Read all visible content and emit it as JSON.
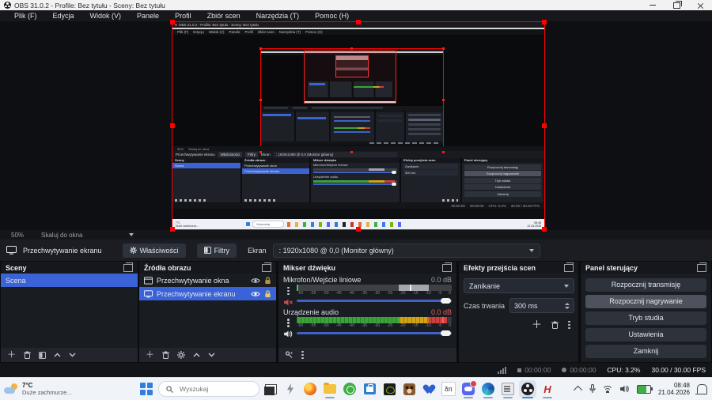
{
  "window": {
    "title": "OBS 31.0.2 - Profile: Bez tytułu - Sceny: Bez tytułu"
  },
  "menu": {
    "items": [
      "Plik (F)",
      "Edycja",
      "Widok (V)",
      "Panele",
      "Profil",
      "Zbiór scen",
      "Narzędzia (T)",
      "Pomoc (H)"
    ]
  },
  "preview": {
    "zoom_label": "50%",
    "scale_mode": "Skaluj do okna"
  },
  "context_bar": {
    "source_label": "Przechwytywanie ekranu",
    "properties_label": "Właściwości",
    "filters_label": "Filtry",
    "screen_label": "Ekran",
    "screen_value": ": 1920x1080 @ 0,0 (Monitor główny)"
  },
  "scenes": {
    "title": "Sceny",
    "items": [
      {
        "label": "Scena",
        "selected": true
      }
    ]
  },
  "sources": {
    "title": "Źródła obrazu",
    "items": [
      {
        "label": "Przechwytywanie okna",
        "selected": false
      },
      {
        "label": "Przechwytywanie ekranu",
        "selected": true
      }
    ]
  },
  "mixer": {
    "title": "Mikser dźwięku",
    "channels": [
      {
        "name": "Mikrofon/Wejście liniowe",
        "level": "0.0 dB",
        "muted": true
      },
      {
        "name": "Urządzenie audio",
        "level": "0.0 dB",
        "muted": false
      }
    ],
    "ticks": [
      "-60",
      "-55",
      "-50",
      "-45",
      "-40",
      "-35",
      "-30",
      "-25",
      "-20",
      "-15",
      "-10",
      "-5",
      "0"
    ]
  },
  "transitions": {
    "title": "Efekty przejścia scen",
    "transition": "Zanikanie",
    "duration_label": "Czas trwania",
    "duration_value": "300 ms"
  },
  "controls": {
    "title": "Panel sterujący",
    "buttons": [
      "Rozpocznij transmisję",
      "Rozpocznij nagrywanie",
      "Tryb studia",
      "Ustawienia",
      "Zamknij"
    ]
  },
  "status_bar": {
    "stream_time": "00:00:00",
    "record_time": "00:00:00",
    "cpu": "CPU: 3.2%",
    "fps": "30.00 / 30.00 FPS"
  },
  "taskbar": {
    "weather_temp": "7°C",
    "weather_desc": "Duże zachmurze...",
    "search_placeholder": "Wyszukaj",
    "math_icon_text": "δπ",
    "h_icon_text": "H",
    "clock_time": "08:48",
    "clock_date": "21.04.2026",
    "icons": [
      "task-view-icon",
      "lightning-icon",
      "firefox-icon",
      "explorer-icon",
      "whatsapp-icon",
      "store-icon",
      "nvidia-icon",
      "game-icon",
      "heart-app-icon",
      "math-app-icon",
      "discord-icon",
      "edge-icon",
      "document-app-icon",
      "obs-icon",
      "h-app-icon"
    ],
    "tray_icons": [
      "tray-chevron-icon",
      "mic-icon",
      "wifi-icon",
      "volume-icon",
      "battery-icon",
      "notification-bell-icon"
    ]
  },
  "colors": {
    "selection_blue": "#3a63d8",
    "canvas_border_red": "#ff0000",
    "meter_green": "#3aa33a",
    "meter_yellow": "#cfa416",
    "meter_red": "#cc4040",
    "titlebar_light": "#f2f2f2",
    "taskbar_light": "#f0f4f9"
  }
}
